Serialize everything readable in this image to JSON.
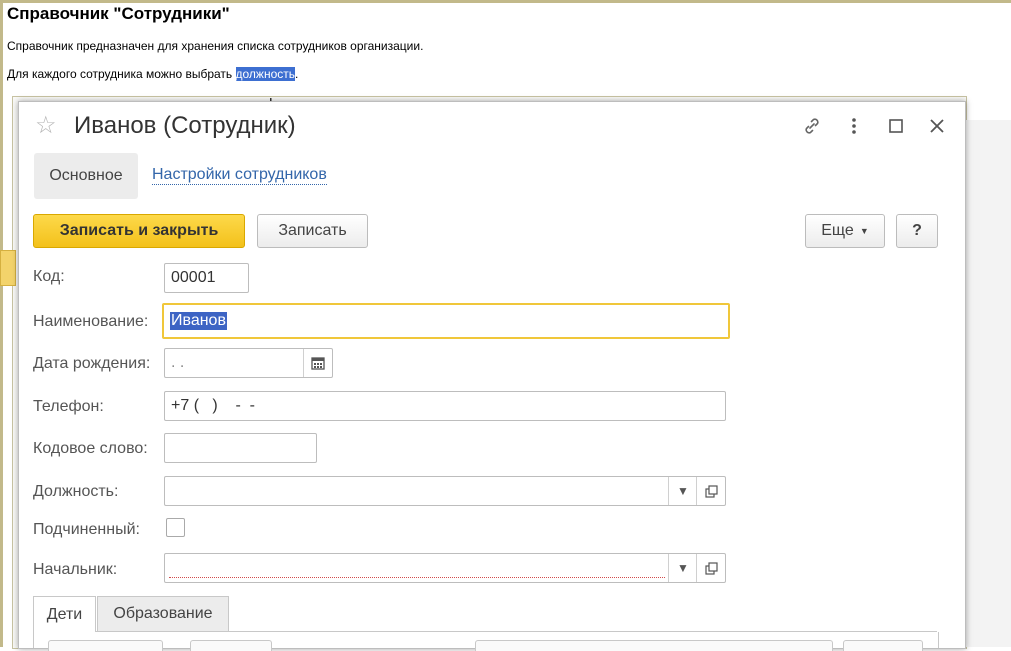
{
  "doc": {
    "title": "Справочник \"Сотрудники\"",
    "p1": "Справочник предназначен для хранения списка сотрудников организации.",
    "p2_prefix": "Для каждого сотрудника можно выбрать ",
    "p2_link": "должность",
    "p2_suffix": "."
  },
  "window": {
    "title": "Иванов (Сотрудник)",
    "icons": [
      "star-icon",
      "link-icon",
      "more-icon",
      "maximize-icon",
      "close-icon"
    ]
  },
  "nav": {
    "main": "Основное",
    "settings": "Настройки сотрудников"
  },
  "toolbar": {
    "save_close": "Записать и закрыть",
    "save": "Записать",
    "more": "Еще",
    "help": "?"
  },
  "form": {
    "code_label": "Код:",
    "code_value": "00001",
    "name_label": "Наименование:",
    "name_value": "Иванов",
    "birth_label": "Дата рождения:",
    "birth_value": " .  .",
    "phone_label": "Телефон:",
    "phone_value": "+7 (   )    -  -",
    "codeword_label": "Кодовое слово:",
    "codeword_value": "",
    "position_label": "Должность:",
    "position_value": "",
    "subordinate_label": "Подчиненный:",
    "subordinate_checked": false,
    "manager_label": "Начальник:",
    "manager_value": ""
  },
  "tabs": {
    "children": "Дети",
    "education": "Образование"
  },
  "colors": {
    "accent_yellow": "#f3c11b",
    "link_blue": "#3366aa",
    "selection_blue": "#3d64c4"
  }
}
